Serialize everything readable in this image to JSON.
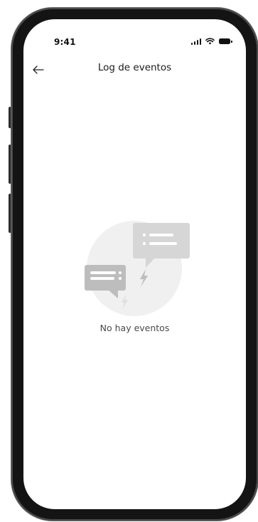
{
  "status_bar": {
    "time": "9:41",
    "icons": [
      "signal-icon",
      "wifi-icon",
      "battery-icon"
    ]
  },
  "header": {
    "back_icon": "arrow-left-icon",
    "title": "Log de eventos"
  },
  "empty_state": {
    "illustration": "chat-bubbles-lightning-illustration",
    "message": "No hay eventos"
  },
  "colors": {
    "illustration_circle": "#f0f0f0",
    "illustration_bubble": "#d6d6d6",
    "illustration_bubble_dark": "#bdbdbd",
    "text_primary": "#1a1a1a",
    "text_secondary": "#4a4a4a"
  }
}
